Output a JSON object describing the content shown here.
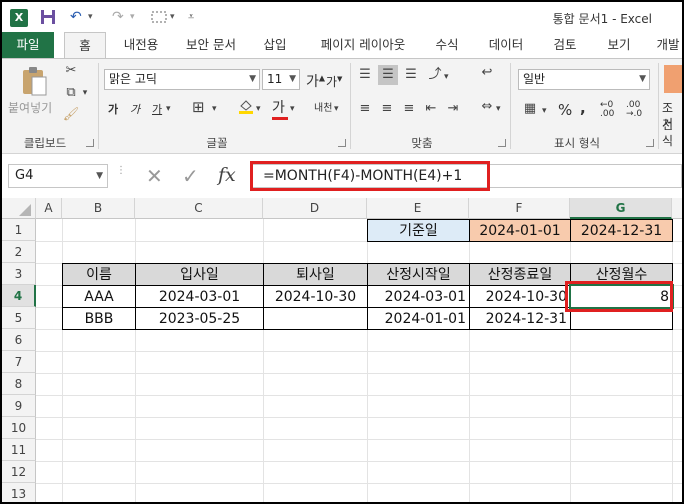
{
  "titlebar": {
    "app_logo": "X",
    "title": "통합 문서1 - Excel"
  },
  "tabs": [
    "파일",
    "홈",
    "내전용",
    "보안 문서",
    "삽입",
    "페이지 레이아웃",
    "수식",
    "데이터",
    "검토",
    "보기",
    "개발"
  ],
  "ribbon": {
    "paste_label": "붙여넣기",
    "clipboard_group": "클립보드",
    "font_name": "맑은 고딕",
    "font_size": "11",
    "font_group": "글꼴",
    "align_group": "맞춤",
    "number_format": "일반",
    "number_group": "표시 형식",
    "conditional_label_1": "조건",
    "conditional_label_2": "서식",
    "bold": "가",
    "italic": "가",
    "underline": "가",
    "font_grow": "가",
    "font_shrink": "가",
    "font_color_letter": "가",
    "phonetic": "내천",
    "percent": "%",
    "comma": ","
  },
  "formula_bar": {
    "name_box": "G4",
    "fx": "fx",
    "formula": "=MONTH(F4)-MONTH(E4)+1"
  },
  "columns": [
    "A",
    "B",
    "C",
    "D",
    "E",
    "F",
    "G"
  ],
  "rows": [
    "1",
    "2",
    "3",
    "4",
    "5",
    "6",
    "7",
    "8",
    "9",
    "10",
    "11",
    "12",
    "13"
  ],
  "sheet": {
    "base_label": "기준일",
    "base_start": "2024-01-01",
    "base_end": "2024-12-31",
    "headers": [
      "이름",
      "입사일",
      "퇴사일",
      "산정시작일",
      "산정종료일",
      "산정월수"
    ],
    "rows": [
      [
        "AAA",
        "2024-03-01",
        "2024-10-30",
        "2024-03-01",
        "2024-10-30",
        "8"
      ],
      [
        "BBB",
        "2023-05-25",
        "",
        "2024-01-01",
        "2024-12-31",
        ""
      ]
    ]
  },
  "colors": {
    "excel_green": "#217346",
    "base_label_fill": "#ddebf7",
    "base_date_fill": "#f8cbad",
    "header_fill": "#d9d9d9",
    "highlight": "#e02020"
  }
}
